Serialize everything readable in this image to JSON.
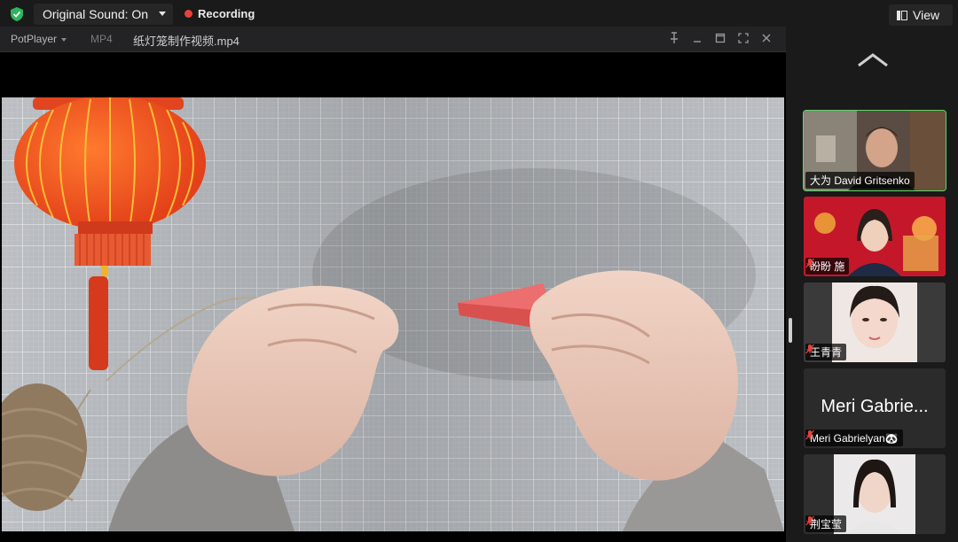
{
  "topbar": {
    "original_sound": "Original Sound: On",
    "recording": "Recording",
    "view": "View",
    "shield_color": "#2db55d",
    "recording_color": "#e8413d"
  },
  "player": {
    "app": "PotPlayer",
    "format": "MP4",
    "filename": "纸灯笼制作视频.mp4",
    "controls": [
      "pin-icon",
      "minimize-icon",
      "maximize-icon",
      "fullscreen-icon",
      "close-icon"
    ]
  },
  "participants": [
    {
      "name": "大为 David Gritsenko",
      "active": true,
      "muted": false
    },
    {
      "name": "盼盼 施",
      "active": false,
      "muted": true
    },
    {
      "name": "王青青",
      "active": false,
      "muted": true
    },
    {
      "name": "Meri Gabrielyan🐼",
      "display_name": "Meri Gabrie...",
      "active": false,
      "muted": true
    },
    {
      "name": "荆宝莹",
      "active": false,
      "muted": true
    }
  ],
  "colors": {
    "active_border": "#61d36a",
    "mute_icon": "#e8413d"
  }
}
